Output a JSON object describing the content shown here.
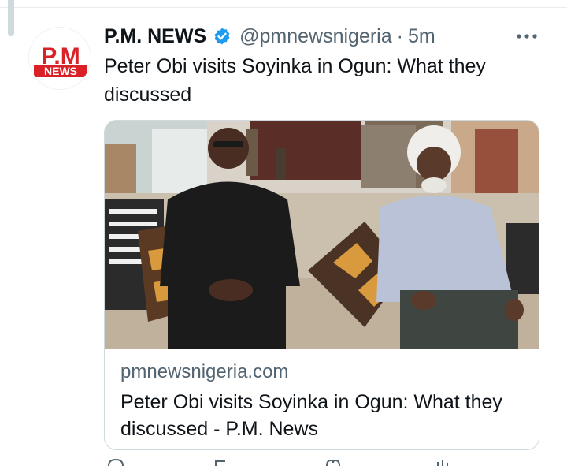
{
  "tweet": {
    "author_name": "P.M. NEWS",
    "handle": "@pmnewsnigeria",
    "separator": "·",
    "time": "5m",
    "avatar_logo": {
      "top": "P.M",
      "bottom": "NEWS",
      "brand_color": "#d92127"
    },
    "text": "Peter Obi visits Soyinka in Ogun: What they discussed",
    "verified_color": "#1d9bf0"
  },
  "card": {
    "domain": "pmnewsnigeria.com",
    "title": "Peter Obi visits Soyinka in Ogun: What they discussed - P.M. News",
    "image_description_icon": "photo-two-men-on-sofa"
  },
  "icons": {
    "more": "more-horizontal-icon",
    "verified": "verified-badge-icon",
    "reply": "reply-icon",
    "retweet": "retweet-icon",
    "like": "like-icon",
    "views": "views-icon"
  }
}
